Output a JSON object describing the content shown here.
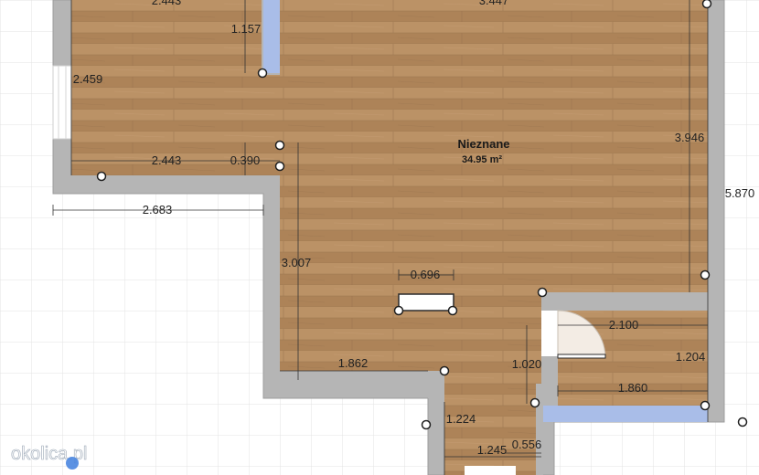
{
  "room": {
    "name": "Nieznane",
    "area": "34.95 m²"
  },
  "dimensions": {
    "top_left": "2.443",
    "top_right": "3.447",
    "wall_segment": "1.157",
    "left_height": "2.459",
    "bottom_left": "2.443",
    "small_gap": "0.390",
    "right_height": "3.946",
    "overall_height": "5.870",
    "outer_bottom": "2.683",
    "mid_height": "3.007",
    "pillar_width": "0.696",
    "closet_width": "2.100",
    "closet_height": "1.204",
    "lower_width": "1.862",
    "door_height": "1.020",
    "closet_bottom": "1.860",
    "corridor_height": "1.224",
    "corridor_width": "1.245",
    "corridor_gap": "0.556"
  },
  "watermark": "okolica.pl",
  "colors": {
    "wall": "#b5b5b5",
    "floor": "#b48a5f",
    "window": "#a9bde8",
    "grid": "#e3e3e3"
  }
}
